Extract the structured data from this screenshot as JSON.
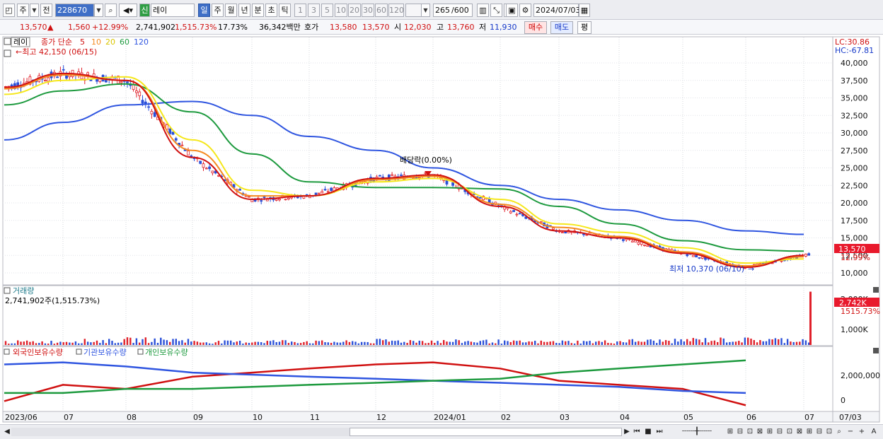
{
  "toolbar": {
    "market_tab": "주",
    "prev_tab": "전",
    "stock_code": "228670",
    "stock_tag": "신",
    "stock_name": "레이",
    "periods": [
      "일",
      "주",
      "월",
      "년",
      "분",
      "초",
      "틱"
    ],
    "intervals": [
      "1",
      "3",
      "5",
      "10",
      "20",
      "30",
      "60",
      "120"
    ],
    "count": "265",
    "count_total": "/600",
    "date": "2024/07/03"
  },
  "info": {
    "price": "13,570",
    "change": "1,560",
    "change_pct": "+12.99%",
    "volume": "2,741,902",
    "volume_pct": "1,515.73%",
    "turnover": "17.73%",
    "amount": "36,342백만",
    "ask_label": "호가",
    "ask": "13,580",
    "bid": "13,570",
    "open_label": "시",
    "open": "12,030",
    "high_label": "고",
    "high": "13,760",
    "low_label": "저",
    "low": "11,930",
    "buy_btn": "매수",
    "sell_btn": "매도",
    "eval_btn": "평"
  },
  "price_panel": {
    "stock_label": "레이",
    "ma_title": "종가 단순",
    "ma_periods": [
      "5",
      "10",
      "20",
      "60",
      "120"
    ],
    "ma_colors": [
      "#d01010",
      "#f58a1f",
      "#f5e71b",
      "#1d9a3e",
      "#2f55e0"
    ],
    "high_marker": "최고 42,150 (06/15)",
    "low_marker": "최저 10,370 (06/10)",
    "dividend_marker": "배당락(0.00%)",
    "lc": "LC:30.86",
    "hc": "HC:-67.81",
    "current_price_tag": "13,570",
    "current_pct_tag": "12.99%",
    "y_ticks": [
      "40,000",
      "37,500",
      "35,000",
      "32,500",
      "30,000",
      "27,500",
      "25,000",
      "22,500",
      "20,000",
      "17,500",
      "15,000",
      "12,500",
      "10,000"
    ]
  },
  "volume_panel": {
    "title": "거래량",
    "summary": "2,741,902주(1,515.73%)",
    "y_ticks": [
      "2,000K",
      "1,000K"
    ],
    "current_tag": "2,742K",
    "current_pct": "1515.73%"
  },
  "holdings_panel": {
    "legends": [
      "외국인보유수량",
      "기관보유수량",
      "개인보유수량"
    ],
    "legend_colors": [
      "#d01010",
      "#2f55e0",
      "#1d9a3e"
    ],
    "y_ticks": [
      "2,000,000",
      "0"
    ]
  },
  "x_axis": {
    "labels": [
      "2023/06",
      "07",
      "08",
      "09",
      "10",
      "11",
      "12",
      "2024/01",
      "02",
      "03",
      "04",
      "05",
      "06",
      "07"
    ],
    "right_label": "07/03"
  },
  "chart_data": {
    "type": "line",
    "x": [
      "2023/06",
      "07",
      "08",
      "09",
      "10",
      "11",
      "12",
      "2024/01",
      "02",
      "03",
      "04",
      "05",
      "06",
      "07"
    ],
    "series": [
      {
        "name": "5",
        "values": [
          36500,
          38500,
          37500,
          26500,
          20500,
          21000,
          23500,
          24000,
          19500,
          16000,
          15000,
          12800,
          10800,
          12500
        ]
      },
      {
        "name": "10",
        "values": [
          36300,
          38300,
          37500,
          27500,
          21000,
          21000,
          23300,
          23800,
          19800,
          16500,
          15200,
          13000,
          11000,
          12300
        ]
      },
      {
        "name": "20",
        "values": [
          35500,
          37500,
          38000,
          29000,
          21800,
          21000,
          23000,
          23500,
          20500,
          17000,
          15800,
          13600,
          11400,
          12000
        ]
      },
      {
        "name": "60",
        "values": [
          34000,
          36000,
          37000,
          33000,
          27000,
          23000,
          22200,
          22200,
          22000,
          19500,
          17000,
          14600,
          13300,
          13100
        ]
      },
      {
        "name": "120",
        "values": [
          29000,
          31500,
          34000,
          34500,
          32500,
          29500,
          27500,
          25000,
          22500,
          20500,
          19000,
          17500,
          16000,
          15500
        ]
      }
    ],
    "volume": [
      150,
      200,
      250,
      150,
      180,
      150,
      200,
      180,
      150,
      160,
      200,
      250,
      2742
    ],
    "holdings_foreign": [
      -10,
      30,
      20,
      50,
      60,
      70,
      80,
      85,
      70,
      40,
      30,
      20,
      -20
    ],
    "holdings_institution": [
      80,
      85,
      75,
      60,
      55,
      50,
      45,
      40,
      35,
      30,
      25,
      15,
      10
    ],
    "holdings_individual": [
      10,
      10,
      20,
      20,
      25,
      30,
      35,
      40,
      45,
      60,
      70,
      80,
      90
    ],
    "ylim": [
      10000,
      42000
    ]
  }
}
